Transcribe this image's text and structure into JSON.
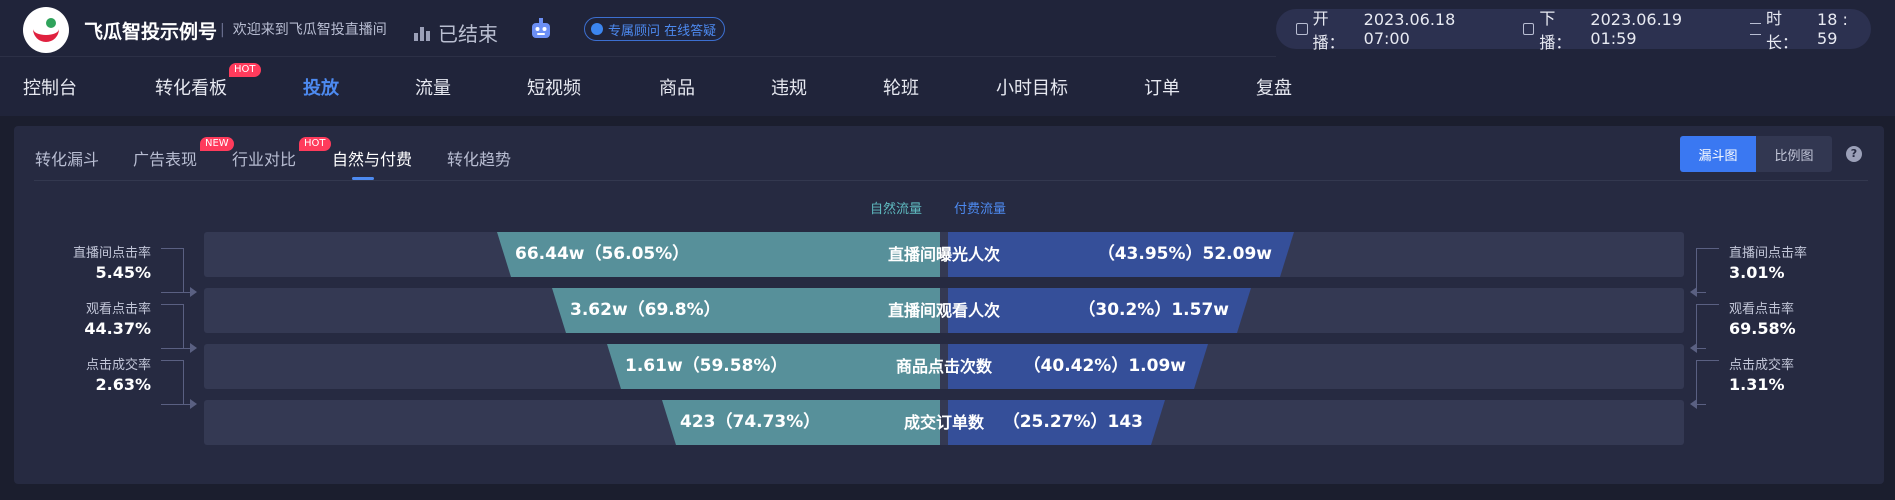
{
  "header": {
    "brand": "飞瓜智投示例号",
    "welcome": "欢迎来到飞瓜智投直播间",
    "status": "已结束",
    "consult": "专属顾问 在线答疑",
    "start_label": "开播：",
    "start_time": "2023.06.18 07:00",
    "end_label": "下播：",
    "end_time": "2023.06.19 01:59",
    "duration_label": "时长：",
    "duration": "18 : 59"
  },
  "nav": {
    "items": [
      "控制台",
      "转化看板",
      "投放",
      "流量",
      "短视频",
      "商品",
      "违规",
      "轮班",
      "小时目标",
      "订单",
      "复盘"
    ],
    "hot_badge": "HOT"
  },
  "subtabs": {
    "items": [
      "转化漏斗",
      "广告表现",
      "行业对比",
      "自然与付费",
      "转化趋势"
    ],
    "new_badge": "NEW",
    "hot_badge": "HOT"
  },
  "view_toggle": {
    "funnel": "漏斗图",
    "ratio": "比例图"
  },
  "legend": {
    "natural": "自然流量",
    "paid": "付费流量"
  },
  "colors": {
    "natural": "#57909a",
    "paid": "#354f99",
    "accent": "#3a78f2",
    "hot": "#ff3b5c"
  },
  "funnel": {
    "rows": [
      {
        "label": "直播间曝光人次",
        "natural": "66.44w（56.05%）",
        "paid": "（43.95%）52.09w",
        "natural_fraction": 1.0,
        "paid_fraction": 0.6
      },
      {
        "label": "直播间观看人次",
        "natural": "3.62w（69.8%）",
        "paid": "（30.2%）1.57w",
        "natural_fraction": 0.53,
        "paid_fraction": 0.53
      },
      {
        "label": "商品点击次数",
        "natural": "1.61w（59.58%）",
        "paid": "（40.42%）1.09w",
        "natural_fraction": 0.45,
        "paid_fraction": 0.45
      },
      {
        "label": "成交订单数",
        "natural": "423（74.73%）",
        "paid": "（25.27%）143",
        "natural_fraction": 0.37,
        "paid_fraction": 0.37
      }
    ],
    "left_metrics": [
      {
        "label": "直播间点击率",
        "value": "5.45%"
      },
      {
        "label": "观看点击率",
        "value": "44.37%"
      },
      {
        "label": "点击成交率",
        "value": "2.63%"
      }
    ],
    "right_metrics": [
      {
        "label": "直播间点击率",
        "value": "3.01%"
      },
      {
        "label": "观看点击率",
        "value": "69.58%"
      },
      {
        "label": "点击成交率",
        "value": "1.31%"
      }
    ]
  }
}
